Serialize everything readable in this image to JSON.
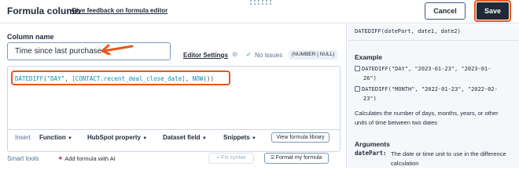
{
  "header": {
    "title": "Formula column",
    "feedback_link": "Give feedback on formula editor",
    "cancel_label": "Cancel",
    "save_label": "Save"
  },
  "column": {
    "label": "Column name",
    "value": "Time since last purchase"
  },
  "status": {
    "editor_settings": "Editor Settings",
    "no_issues": "No issues",
    "type_badge": "(NUMBER | NULL)"
  },
  "formula": {
    "fn": "DATEDIFF",
    "open": "(",
    "arg1": "\"DAY\"",
    "sep1": ", ",
    "arg2": "[CONTACT.recent_deal_close_date]",
    "sep2": ", ",
    "arg3": "NOW",
    "close": "())"
  },
  "toolbar": {
    "insert_label": "Insert",
    "function": "Function",
    "hubspot_property": "HubSpot property",
    "dataset_field": "Dataset field",
    "snippets": "Snippets",
    "view_library": "View formula library",
    "smart_tools_label": "Smart tools",
    "add_ai": "Add formula with AI",
    "fix_syntax": "Fix syntax",
    "format": "Format my formula"
  },
  "docs": {
    "signature": "DATEDIFF(datePart, date1, date2)",
    "example_heading": "Example",
    "example1_line1": "DATEDIFF(\"DAY\", \"2023-01-23\", \"2023-01-",
    "example1_line2": "26\")",
    "example2_line1": "DATEDIFF(\"MONTH\", \"2022-01-23\", \"2022-02-",
    "example2_line2": "23\")",
    "description": "Calculates the number of days, months, years, or other units of time between two dates",
    "arguments_heading": "Arguments",
    "arg_name": "datePart:",
    "arg_desc": "The date or time unit to use in the difference calculation"
  },
  "colors": {
    "accent": "#e8571f",
    "dark_button": "#1f2937",
    "code_token": "#0091ae",
    "ai_spark": "#d63384"
  },
  "icons": {
    "arrow": "arrow-left-icon",
    "gear": "gear-icon",
    "check": "check-icon",
    "copy": "copy-icon",
    "caret": "caret-down-icon",
    "spark": "sparkle-icon",
    "format": "format-icon"
  }
}
